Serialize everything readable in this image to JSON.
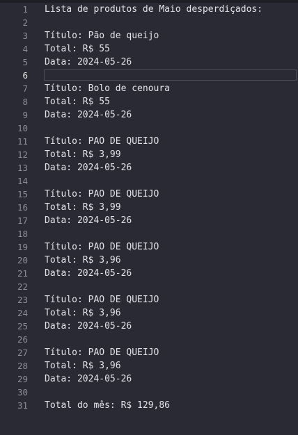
{
  "editor": {
    "current_line": 6,
    "lines": [
      "Lista de produtos de Maio desperdiçados:",
      "",
      "Título: Pão de queijo",
      "Total: R$ 55",
      "Data: 2024-05-26",
      "",
      "Título: Bolo de cenoura",
      "Total: R$ 55",
      "Data: 2024-05-26",
      "",
      "Título: PAO DE QUEIJO",
      "Total: R$ 3,99",
      "Data: 2024-05-26",
      "",
      "Título: PAO DE QUEIJO",
      "Total: R$ 3,99",
      "Data: 2024-05-26",
      "",
      "Título: PAO DE QUEIJO",
      "Total: R$ 3,96",
      "Data: 2024-05-26",
      "",
      "Título: PAO DE QUEIJO",
      "Total: R$ 3,96",
      "Data: 2024-05-26",
      "",
      "Título: PAO DE QUEIJO",
      "Total: R$ 3,96",
      "Data: 2024-05-26",
      "",
      "Total do mês: R$ 129,86"
    ],
    "line_numbers": [
      "1",
      "2",
      "3",
      "4",
      "5",
      "6",
      "7",
      "8",
      "9",
      "10",
      "11",
      "12",
      "13",
      "14",
      "15",
      "16",
      "17",
      "18",
      "19",
      "20",
      "21",
      "22",
      "23",
      "24",
      "25",
      "26",
      "27",
      "28",
      "29",
      "30",
      "31"
    ]
  }
}
